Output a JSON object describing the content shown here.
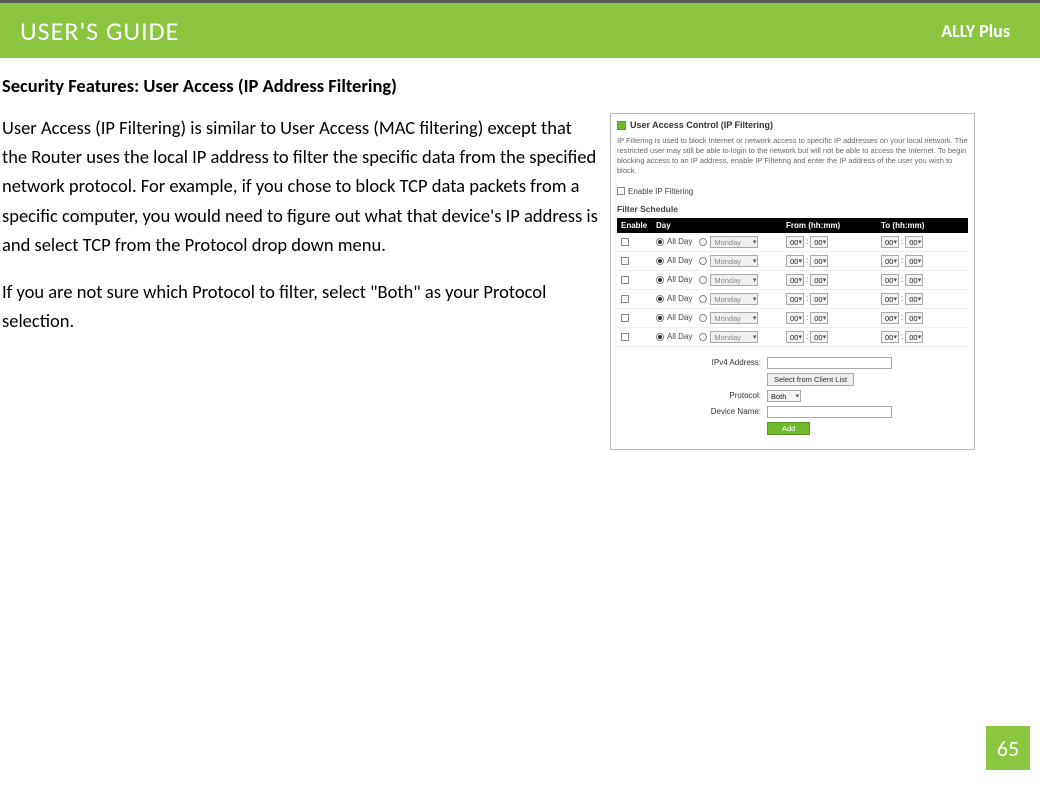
{
  "header": {
    "guide_title": "USER'S GUIDE",
    "brand": "ALLY Plus"
  },
  "section_title": "Security Features: User Access (IP Address Filtering)",
  "paragraphs": [
    "User Access (IP Filtering) is similar to User Access (MAC filtering) except that the Router uses the local IP address to filter the specific data from the specified network protocol. For example, if you chose to block TCP data packets from a specific computer, you would need to figure out what that device's IP address is and select TCP from the Protocol drop down menu.",
    "If you are not sure which Protocol to filter, select \"Both\" as your Protocol selection."
  ],
  "screenshot": {
    "title": "User Access Control (IP Filtering)",
    "description": "IP Filtering is used to block Internet or network access to specific IP addresses on your local network. The restricted user may still be able to login to the network but will not be able to access the Internet. To begin blocking access to an IP address, enable IP Filtering and enter the IP address of the user you wish to block.",
    "enable_label": "Enable IP Filtering",
    "schedule_label": "Filter Schedule",
    "table_headers": {
      "enable": "Enable",
      "day": "Day",
      "from": "From (hh:mm)",
      "to": "To (hh:mm)"
    },
    "row_defaults": {
      "all_day": "All Day",
      "day_select": "Monday",
      "hour": "00",
      "min": "00"
    },
    "row_count": 6,
    "form": {
      "ipv4_label": "IPv4 Address:",
      "select_client_btn": "Select from Client List",
      "protocol_label": "Protocol:",
      "protocol_value": "Both",
      "device_name_label": "Device Name:",
      "add_btn": "Add"
    }
  },
  "page_number": "65"
}
